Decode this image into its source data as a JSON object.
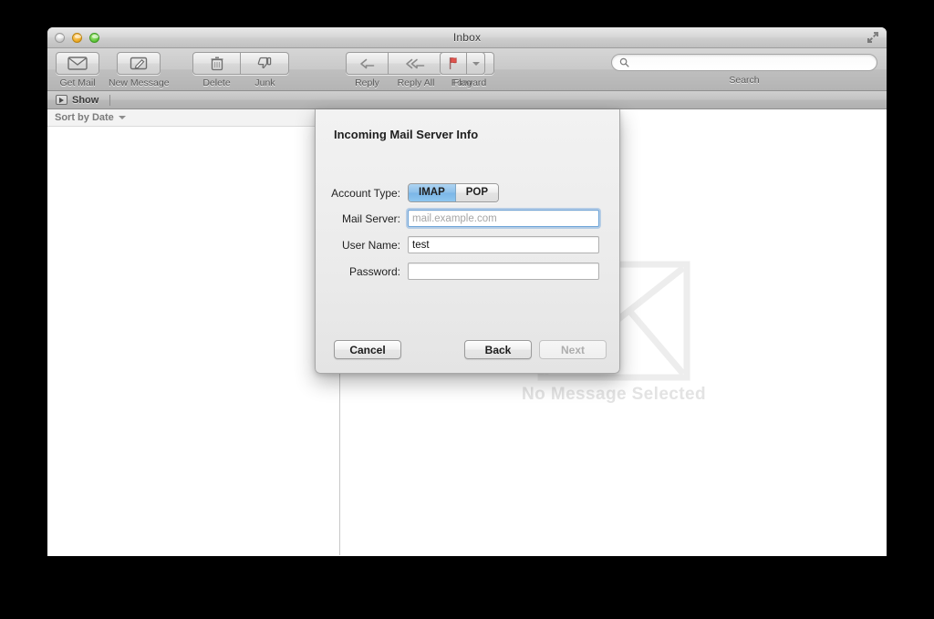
{
  "window": {
    "title": "Inbox",
    "traffic_lights": [
      "close",
      "minimize",
      "zoom"
    ],
    "fullscreen_icon": "fullscreen-icon"
  },
  "toolbar": {
    "items": [
      {
        "label": "Get Mail",
        "icon": "envelope-icon"
      },
      {
        "label": "New Message",
        "icon": "compose-pencil-icon"
      },
      {
        "label": "Delete",
        "icon": "trash-icon"
      },
      {
        "label": "Junk",
        "icon": "thumbs-down-icon"
      },
      {
        "label": "Reply",
        "icon": "reply-arrow-icon"
      },
      {
        "label": "Reply All",
        "icon": "reply-all-arrow-icon"
      },
      {
        "label": "Forward",
        "icon": "forward-arrow-icon"
      },
      {
        "label": "Flag",
        "icon": "flag-icon"
      }
    ],
    "search": {
      "value": "",
      "placeholder": "",
      "caption": "Search",
      "icon": "search-icon"
    }
  },
  "showbar": {
    "label": "Show",
    "icon": "disclosure-triangle-icon"
  },
  "message_list": {
    "sort_label": "Sort by Date",
    "caret": "chevron-down-icon"
  },
  "reading_pane": {
    "empty_caption": "No Message Selected",
    "watermark_icon": "envelope-watermark-icon"
  },
  "sheet": {
    "title": "Incoming Mail Server Info",
    "fields": [
      {
        "label": "Account Type:",
        "type": "segmented",
        "options": [
          "IMAP",
          "POP"
        ],
        "selected": "IMAP"
      },
      {
        "label": "Mail Server:",
        "type": "text",
        "value": "",
        "placeholder": "mail.example.com",
        "focused": true
      },
      {
        "label": "User Name:",
        "type": "text",
        "value": "test",
        "placeholder": "",
        "focused": false
      },
      {
        "label": "Password:",
        "type": "password",
        "value": "",
        "placeholder": "",
        "focused": false
      }
    ],
    "buttons": {
      "cancel": "Cancel",
      "back": "Back",
      "next": "Next",
      "next_disabled": true
    }
  },
  "colors": {
    "accent_blue": "#8dc0ea",
    "focus_ring": "#6fa5d8",
    "watermark_gray": "#e3e3e3",
    "toolbar_gray": "#c9c9c9",
    "desktop": "#000000"
  }
}
